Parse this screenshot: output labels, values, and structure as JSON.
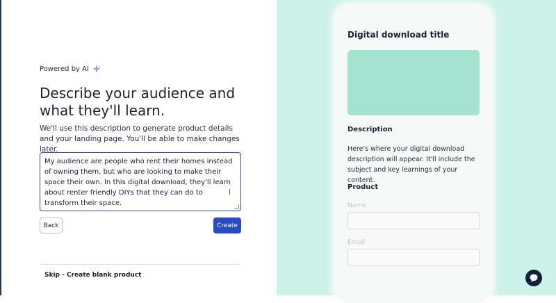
{
  "form": {
    "powered_by": "Powered by AI",
    "headline": "Describe your audience and what they'll learn.",
    "subtext": "We'll use this description to generate product details and your landing page. You'll be able to make changes later.",
    "description_value": "My audience are people who rent their homes instead of owning them, but who are looking to make their space their own. In this digital download, they'll learn about renter friendly DIYs that they can do to transform their space.",
    "back_label": "Back",
    "create_label": "Create",
    "skip_label": "Skip - Create blank product"
  },
  "preview": {
    "title": "Digital download title",
    "description_heading": "Description",
    "description_text": "Here's where your digital download description will appear. It'll include the subject and key learnings of your content.",
    "product_heading": "Product",
    "name_label": "Name",
    "email_label": "Email"
  },
  "colors": {
    "accent": "#2a4bc0",
    "preview_bg": "#cdf2e8",
    "image_placeholder": "#a4e3cf",
    "chat_button": "#0e2140"
  },
  "icons": {
    "sparkle": "sparkle-icon",
    "chat": "chat-bubble-icon",
    "text_cursor": "text-cursor-icon"
  }
}
